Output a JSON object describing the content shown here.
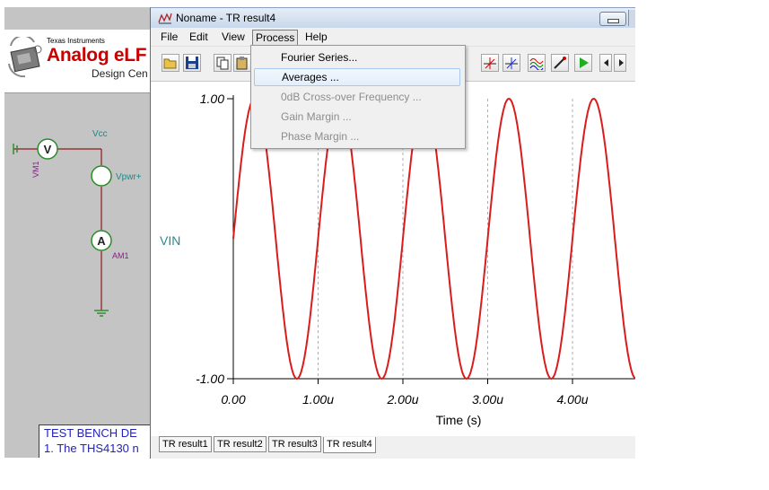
{
  "background_app": {
    "logo": {
      "company": "Texas Instruments",
      "product": "Analog eLF",
      "subtitle": "Design Cen"
    },
    "schematic": {
      "vcc_label": "Vcc",
      "vpwr_label": "Vpwr+",
      "vm_label": "VM1",
      "am_label": "AM1",
      "voltmeter_symbol": "V",
      "ammeter_symbol": "A"
    },
    "testbench": {
      "line1": "TEST BENCH DE",
      "line2": "1. The THS4130 n"
    }
  },
  "window": {
    "title": "Noname - TR result4",
    "menus": [
      "File",
      "Edit",
      "View",
      "Process",
      "Help"
    ],
    "active_menu": "Process",
    "toolbar_icons": [
      "open-folder-icon",
      "save-disk-icon",
      "copy-icon",
      "clipboard-icon",
      "cursor-a-icon",
      "cursor-b-icon",
      "waveform-icon",
      "probe-icon",
      "run-play-icon",
      "scroll-left-icon",
      "scroll-right-icon"
    ]
  },
  "process_menu": {
    "items": [
      {
        "label": "Fourier Series...",
        "enabled": true
      },
      {
        "label": "Averages ...",
        "enabled": true,
        "highlighted": true
      },
      {
        "label": "0dB Cross-over Frequency ...",
        "enabled": false
      },
      {
        "label": "Gain Margin ...",
        "enabled": false
      },
      {
        "label": "Phase Margin ...",
        "enabled": false
      }
    ]
  },
  "tabs": [
    {
      "label": "TR result1",
      "active": false
    },
    {
      "label": "TR result2",
      "active": false
    },
    {
      "label": "TR result3",
      "active": false
    },
    {
      "label": "TR result4",
      "active": true
    }
  ],
  "chart_data": {
    "type": "line",
    "series": [
      {
        "name": "VIN",
        "function": "sine",
        "amplitude": 1.0,
        "frequency_MHz": 1.0,
        "phase_start": 0,
        "x": [
          0,
          0.25,
          0.5,
          0.75,
          1.0,
          1.25,
          1.5,
          1.75,
          2.0,
          2.25,
          2.5,
          2.75,
          3.0,
          3.25,
          3.5,
          3.75,
          4.0,
          4.25,
          4.5,
          4.75
        ],
        "y": [
          0,
          1,
          0,
          -1,
          0,
          1,
          0,
          -1,
          0,
          1,
          0,
          -1,
          0,
          1,
          0,
          -1,
          0,
          1,
          0,
          -1
        ]
      }
    ],
    "xlabel": "Time (s)",
    "ylabel": "VIN",
    "xlim": [
      0,
      4.75
    ],
    "ylim": [
      -1.0,
      1.0
    ],
    "x_ticks": [
      "0.00",
      "1.00u",
      "2.00u",
      "3.00u",
      "4.00u"
    ],
    "x_tick_values": [
      0,
      1,
      2,
      3,
      4
    ],
    "y_ticks": [
      "1.00",
      "-1.00"
    ],
    "y_tick_values": [
      1.0,
      -1.0
    ],
    "grid": "vertical dashed",
    "line_color": "#d91c1c"
  }
}
